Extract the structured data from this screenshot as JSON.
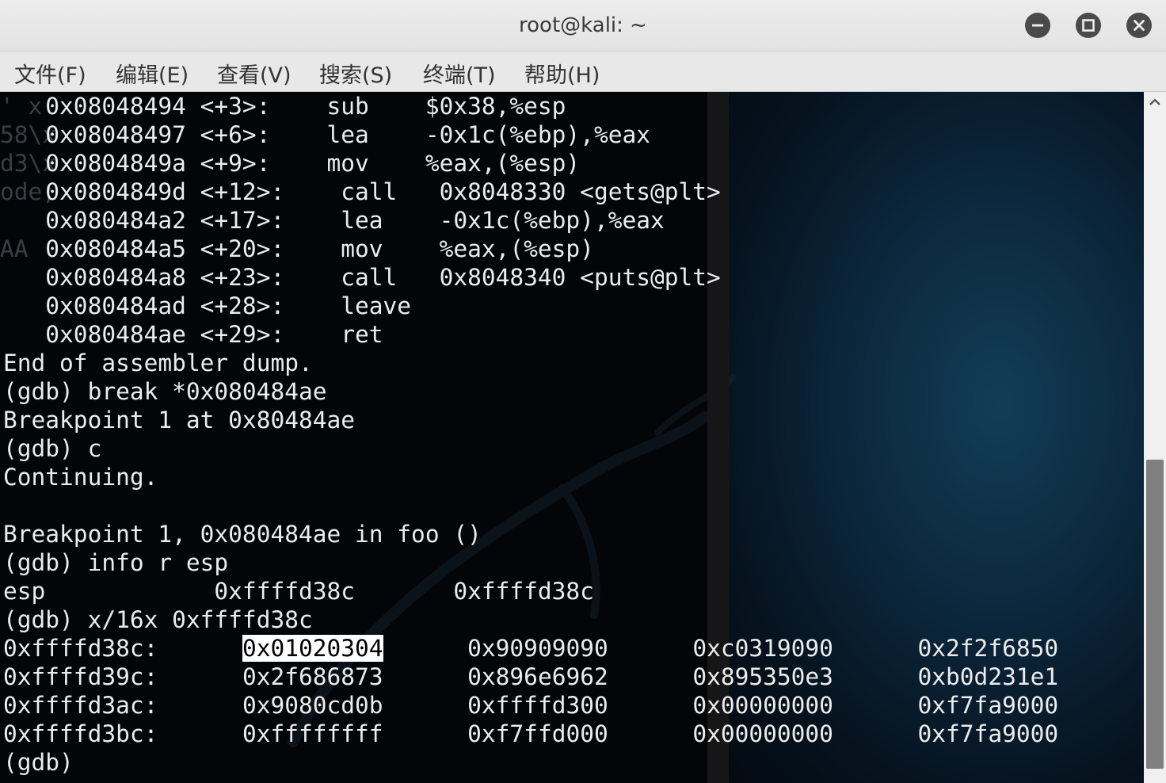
{
  "window": {
    "title": "root@kali: ~",
    "controls": {
      "minimize": "minimize-icon",
      "maximize": "maximize-icon",
      "close": "close-icon"
    }
  },
  "menu": {
    "items": [
      "文件(F)",
      "编辑(E)",
      "查看(V)",
      "搜索(S)",
      "终端(T)",
      "帮助(H)"
    ]
  },
  "terminal": {
    "ghost_text": [
      "' x",
      "58\\x",
      "d3\\x",
      "ode;",
      "",
      "AA"
    ],
    "lines": [
      "   0x08048494 <+3>:    sub    $0x38,%esp",
      "   0x08048497 <+6>:    lea    -0x1c(%ebp),%eax",
      "   0x0804849a <+9>:    mov    %eax,(%esp)",
      "   0x0804849d <+12>:    call   0x8048330 <gets@plt>",
      "   0x080484a2 <+17>:    lea    -0x1c(%ebp),%eax",
      "   0x080484a5 <+20>:    mov    %eax,(%esp)",
      "   0x080484a8 <+23>:    call   0x8048340 <puts@plt>",
      "   0x080484ad <+28>:    leave",
      "   0x080484ae <+29>:    ret",
      "End of assembler dump.",
      "(gdb) break *0x080484ae",
      "Breakpoint 1 at 0x80484ae",
      "(gdb) c",
      "Continuing.",
      "",
      "Breakpoint 1, 0x080484ae in foo ()",
      "(gdb) info r esp",
      "esp            0xffffd38c       0xffffd38c",
      "(gdb) x/16x 0xffffd38c"
    ],
    "mem_rows": [
      {
        "addr": "0xffffd38c:",
        "words": [
          "0x01020304",
          "0x90909090",
          "0xc0319090",
          "0x2f2f6850"
        ]
      },
      {
        "addr": "0xffffd39c:",
        "words": [
          "0x2f686873",
          "0x896e6962",
          "0x895350e3",
          "0xb0d231e1"
        ]
      },
      {
        "addr": "0xffffd3ac:",
        "words": [
          "0x9080cd0b",
          "0xffffd300",
          "0x00000000",
          "0xf7fa9000"
        ]
      },
      {
        "addr": "0xffffd3bc:",
        "words": [
          "0xffffffff",
          "0xf7ffd000",
          "0x00000000",
          "0xf7fa9000"
        ]
      }
    ],
    "prompt": "(gdb)"
  },
  "colors": {
    "terminal_bg": "#030508",
    "terminal_fg": "#ececec",
    "titlebar_bg": "#e8e8e8",
    "highlight_bg": "#ffffff"
  }
}
